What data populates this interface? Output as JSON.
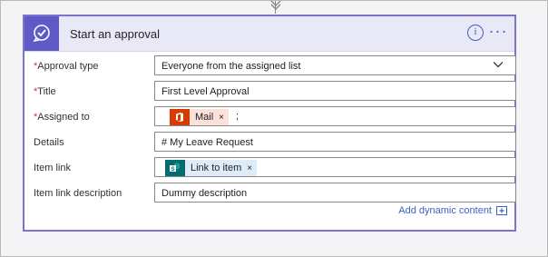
{
  "header": {
    "title": "Start an approval",
    "info_glyph": "i",
    "more_glyph": "···"
  },
  "fields": {
    "approval_type": {
      "label": "Approval type",
      "required": true,
      "value": "Everyone from the assigned list"
    },
    "title": {
      "label": "Title",
      "required": true,
      "value": "First Level Approval"
    },
    "assigned_to": {
      "label": "Assigned to",
      "required": true,
      "token_label": "Mail",
      "separator": ";"
    },
    "details": {
      "label": "Details",
      "required": false,
      "value": "# My Leave Request"
    },
    "item_link": {
      "label": "Item link",
      "required": false,
      "token_label": "Link to item"
    },
    "item_link_description": {
      "label": "Item link description",
      "required": false,
      "value": "Dummy description"
    }
  },
  "required_marker": "*",
  "token_remove_glyph": "×",
  "dynamic_content": {
    "label": "Add dynamic content"
  },
  "colors": {
    "accent": "#5e5ac8",
    "link": "#3a62c4",
    "office_red": "#d83b01",
    "sharepoint_teal": "#036c70"
  },
  "icons": [
    "approval-icon",
    "info-icon",
    "more-options-icon",
    "chevron-down-icon",
    "office-icon",
    "sharepoint-icon",
    "add-dynamic-content-icon",
    "connector-arrow-icon"
  ]
}
